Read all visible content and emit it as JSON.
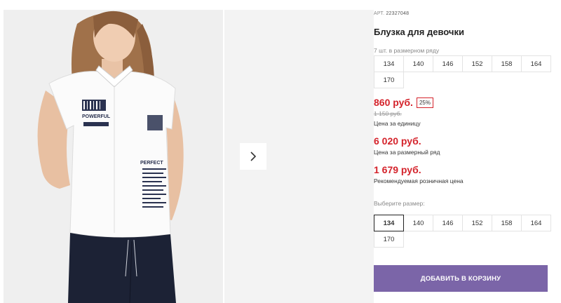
{
  "gallery": {
    "next_icon": "chevron-right-icon",
    "photo_description": "Girl wearing white short-sleeve blouse with navy prints and dark trousers",
    "print_text": {
      "powerful": "POWERFUL",
      "perfect": "PERFECT"
    }
  },
  "product": {
    "article_label": "АРТ.",
    "article_number": "22327048",
    "title": "Блузка для девочки",
    "set_note": "7 шт. в размерном ряду",
    "set_sizes": [
      "134",
      "140",
      "146",
      "152",
      "158",
      "164",
      "170"
    ],
    "price": "860 руб.",
    "discount": "25%",
    "old_price": "1 150 руб.",
    "unit_price_caption": "Цена за единицу",
    "set_price": "6 020 руб.",
    "set_price_caption": "Цена за размерный ряд",
    "retail_price": "1 679 руб.",
    "retail_price_caption": "Рекомендуемая розничная цена",
    "choose_size_label": "Выберите размер:",
    "choose_sizes": [
      "134",
      "140",
      "146",
      "152",
      "158",
      "164",
      "170"
    ],
    "selected_size": "134",
    "add_to_cart": "ДОБАВИТЬ В КОРЗИНУ"
  },
  "colors": {
    "accent_button": "#7b65a8",
    "price_red": "#d4232b"
  }
}
